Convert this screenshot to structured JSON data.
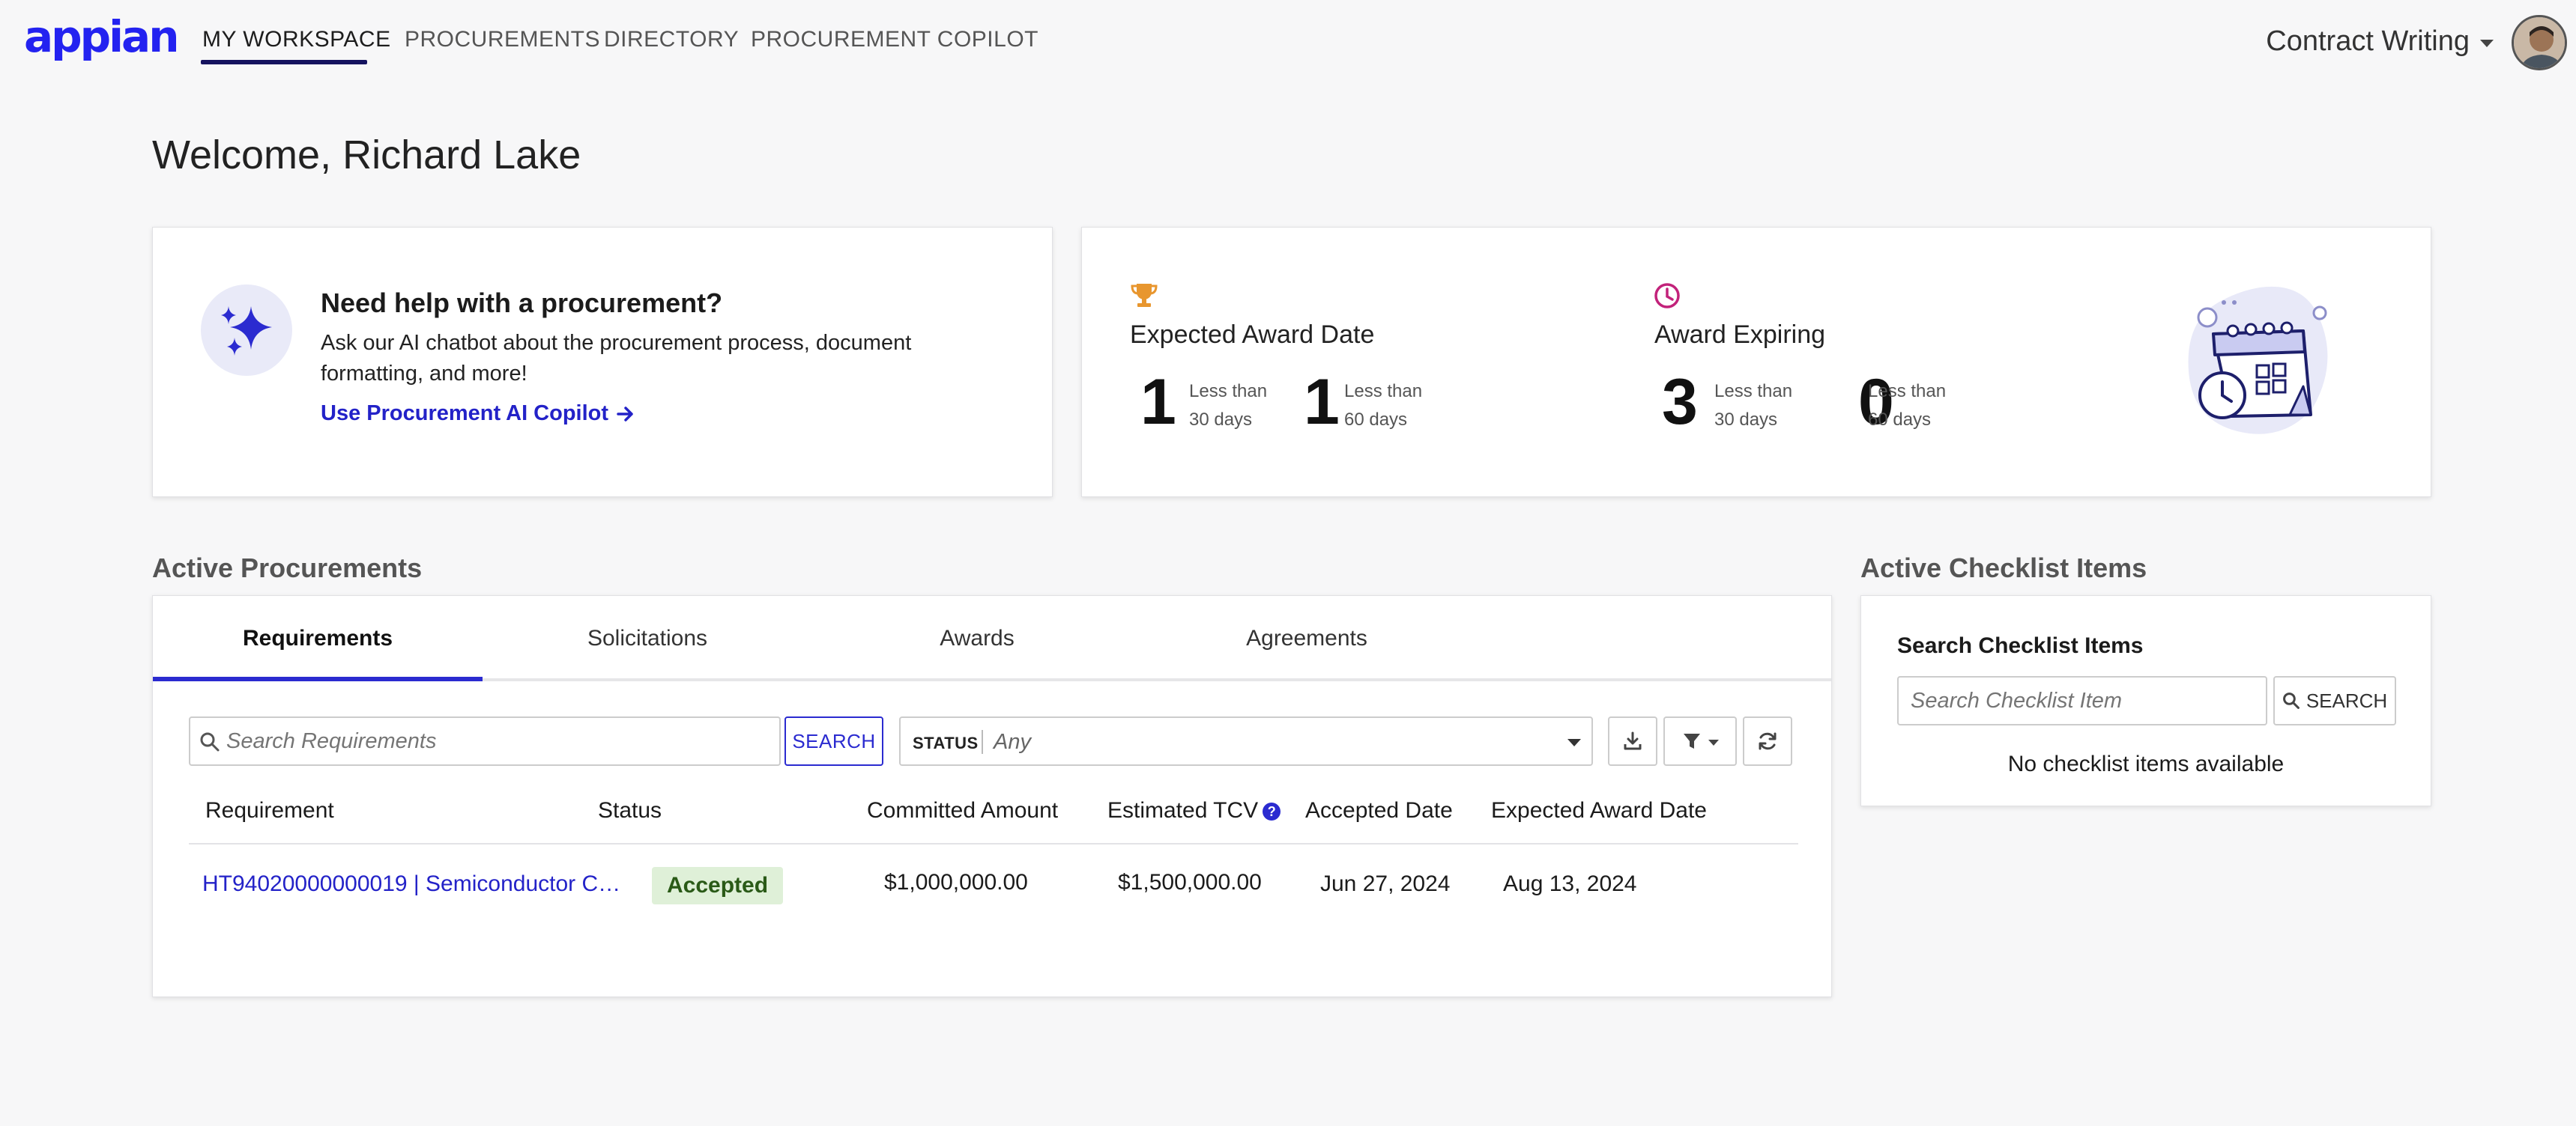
{
  "header": {
    "logo": "appian",
    "nav": [
      {
        "label": "MY WORKSPACE",
        "active": true
      },
      {
        "label": "PROCUREMENTS",
        "active": false
      },
      {
        "label": "DIRECTORY",
        "active": false
      },
      {
        "label": "PROCUREMENT COPILOT",
        "active": false
      }
    ],
    "app_name": "Contract Writing",
    "brand_color": "#2322f0"
  },
  "welcome": "Welcome, Richard Lake",
  "help_card": {
    "title": "Need help with a procurement?",
    "text": "Ask our AI chatbot about the procurement process, document formatting, and more!",
    "link": "Use Procurement AI Copilot",
    "icon": "sparkle-icon"
  },
  "stats": {
    "expected_award": {
      "title": "Expected Award Date",
      "icon": "trophy-icon",
      "items": [
        {
          "value": "1",
          "line1": "Less than",
          "line2": "30 days"
        },
        {
          "value": "1",
          "line1": "Less than",
          "line2": "60 days"
        }
      ]
    },
    "award_expiring": {
      "title": "Award Expiring",
      "icon": "clock-icon",
      "items": [
        {
          "value": "3",
          "line1": "Less than",
          "line2": "30 days"
        },
        {
          "value": "0",
          "line1": "Less than",
          "line2": "60 days"
        }
      ]
    }
  },
  "active_procurements": {
    "title": "Active Procurements",
    "tabs": [
      "Requirements",
      "Solicitations",
      "Awards",
      "Agreements"
    ],
    "search_placeholder": "Search Requirements",
    "search_button": "SEARCH",
    "status_label": "STATUS",
    "status_value": "Any",
    "columns": [
      "Requirement",
      "Status",
      "Committed Amount",
      "Estimated TCV",
      "Accepted Date",
      "Expected Award Date"
    ],
    "rows": [
      {
        "requirement": "HT94020000000019 | Semiconductor Ch...",
        "status": "Accepted",
        "committed_amount": "$1,000,000.00",
        "estimated_tcv": "$1,500,000.00",
        "accepted_date": "Jun 27, 2024",
        "expected_award_date": "Aug 13, 2024"
      }
    ]
  },
  "checklist": {
    "title": "Active Checklist Items",
    "label": "Search Checklist Items",
    "placeholder": "Search Checklist Item",
    "button": "SEARCH",
    "empty": "No checklist items available"
  }
}
